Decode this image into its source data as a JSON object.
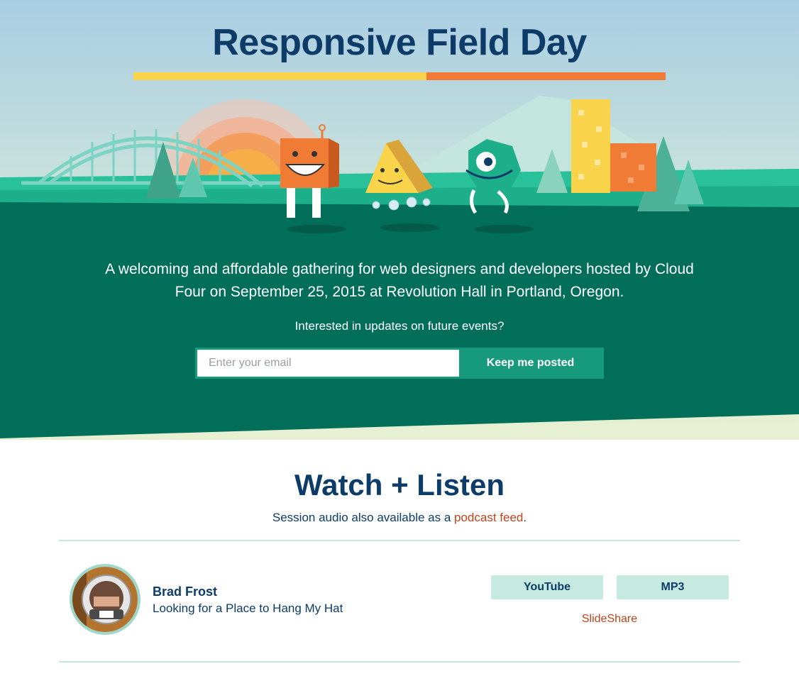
{
  "hero": {
    "title": "Responsive Field Day",
    "intro": "A welcoming and affordable gathering for web designers and developers hosted by Cloud Four on September 25, 2015 at Revolution Hall in Portland, Oregon.",
    "updates_prompt": "Interested in updates on future events?",
    "email_placeholder": "Enter your email",
    "subscribe_label": "Keep me posted"
  },
  "watch": {
    "title": "Watch + Listen",
    "subtitle_prefix": "Session audio also available as a",
    "podcast_link": "podcast feed",
    "subtitle_suffix": ".",
    "sessions": [
      {
        "speaker": "Brad Frost",
        "talk": "Looking for a Place to Hang My Hat",
        "youtube_label": "YouTube",
        "mp3_label": "MP3",
        "slides_label": "SlideShare"
      }
    ]
  },
  "colors": {
    "navy": "#0d3c68",
    "dark_green": "#006e59",
    "accent_green": "#169a7b",
    "yellow": "#f9d44a",
    "orange": "#f07b34",
    "link_red": "#c2421b"
  }
}
